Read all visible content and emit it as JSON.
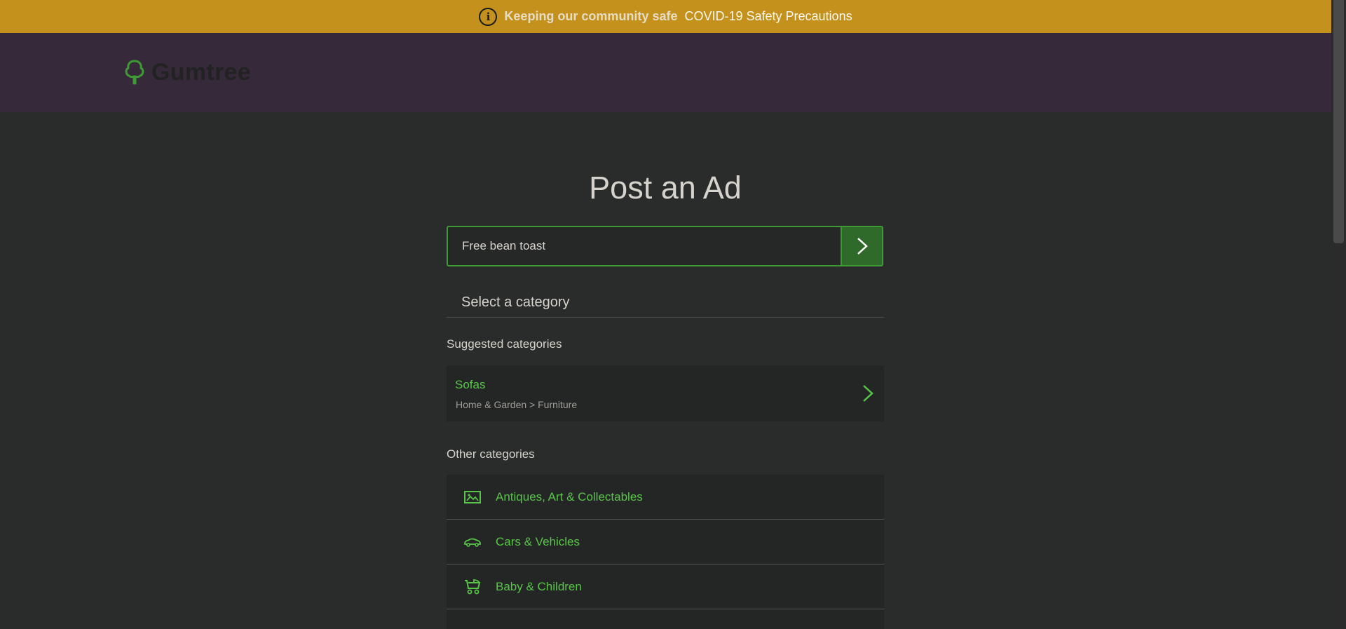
{
  "banner": {
    "safe_text": "Keeping our community safe",
    "link_text": "COVID-19 Safety Precautions",
    "icon": "info-icon",
    "color": "#c4921c"
  },
  "header": {
    "logo_text": "Gumtree",
    "logo_icon": "tree-icon",
    "color": "#36293a"
  },
  "main": {
    "title": "Post an Ad",
    "search": {
      "value": "Free bean toast",
      "button_icon": "chevron-right-icon"
    },
    "select_category_label": "Select a category",
    "suggested_label": "Suggested categories",
    "suggested": [
      {
        "name": "Sofas",
        "path": "Home & Garden > Furniture"
      }
    ],
    "other_label": "Other categories",
    "categories": [
      {
        "label": "Antiques, Art & Collectables",
        "icon": "picture-icon"
      },
      {
        "label": "Cars & Vehicles",
        "icon": "car-icon"
      },
      {
        "label": "Baby & Children",
        "icon": "pram-icon"
      }
    ]
  },
  "colors": {
    "accent": "#58c548",
    "button": "#2f6a2a",
    "background": "#2a2c2c"
  }
}
